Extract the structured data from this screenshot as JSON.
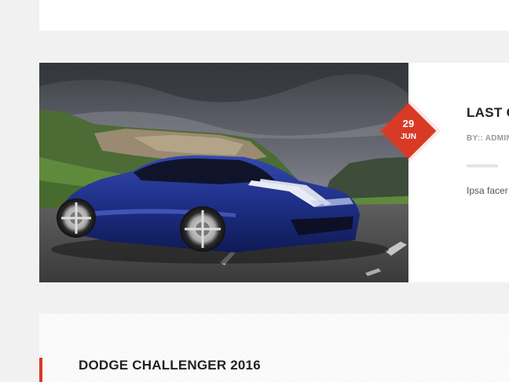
{
  "post": {
    "date_day": "29",
    "date_month": "JUN",
    "title": "LAST C",
    "meta": "BY:: ADMIN",
    "excerpt": "Ipsa facer",
    "image_alt": "Blue sports car on mountain road"
  },
  "section": {
    "title": "DODGE CHALLENGER 2016"
  },
  "colors": {
    "accent": "#d93a26",
    "background": "#f1f1f1",
    "card": "#ffffff",
    "car_body": "#1e2f86"
  }
}
